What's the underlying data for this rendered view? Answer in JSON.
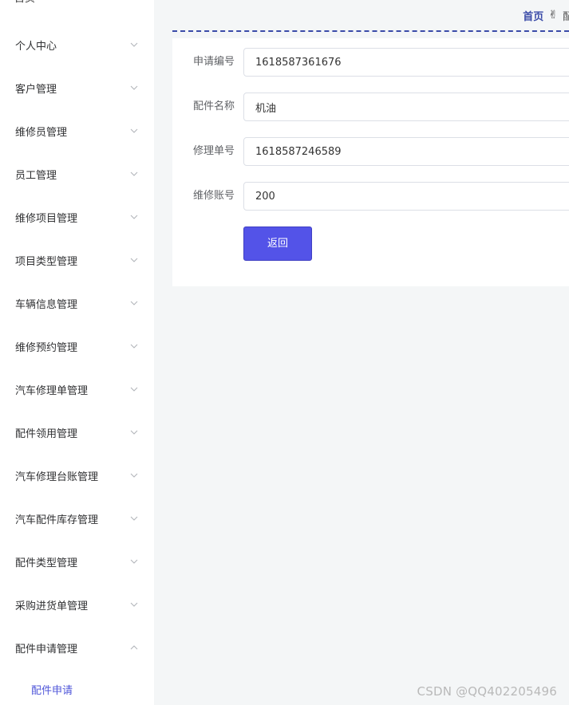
{
  "sidebar": {
    "top_item": "首页",
    "items": [
      {
        "label": "个人中心",
        "expanded": false
      },
      {
        "label": "客户管理",
        "expanded": false
      },
      {
        "label": "维修员管理",
        "expanded": false
      },
      {
        "label": "员工管理",
        "expanded": false
      },
      {
        "label": "维修项目管理",
        "expanded": false
      },
      {
        "label": "项目类型管理",
        "expanded": false
      },
      {
        "label": "车辆信息管理",
        "expanded": false
      },
      {
        "label": "维修预约管理",
        "expanded": false
      },
      {
        "label": "汽车修理单管理",
        "expanded": false
      },
      {
        "label": "配件领用管理",
        "expanded": false
      },
      {
        "label": "汽车修理台账管理",
        "expanded": false
      },
      {
        "label": "汽车配件库存管理",
        "expanded": false
      },
      {
        "label": "配件类型管理",
        "expanded": false
      },
      {
        "label": "采购进货单管理",
        "expanded": false
      },
      {
        "label": "配件申请管理",
        "expanded": true
      }
    ],
    "submenu_item": "配件申请"
  },
  "breadcrumb": {
    "home": "首页",
    "icon": "hand-pointing-icon",
    "next_partial": "配"
  },
  "form": {
    "fields": [
      {
        "label": "申请编号",
        "value": "1618587361676"
      },
      {
        "label": "配件名称",
        "value": "机油"
      },
      {
        "label": "修理单号",
        "value": "1618587246589"
      },
      {
        "label": "维修账号",
        "value": "200"
      }
    ],
    "back_label": "返回"
  },
  "watermark": "CSDN @QQ402205496",
  "colors": {
    "accent": "#5353e8",
    "breadcrumb": "#3a4ba8",
    "main_bg": "#f4f6f7"
  }
}
